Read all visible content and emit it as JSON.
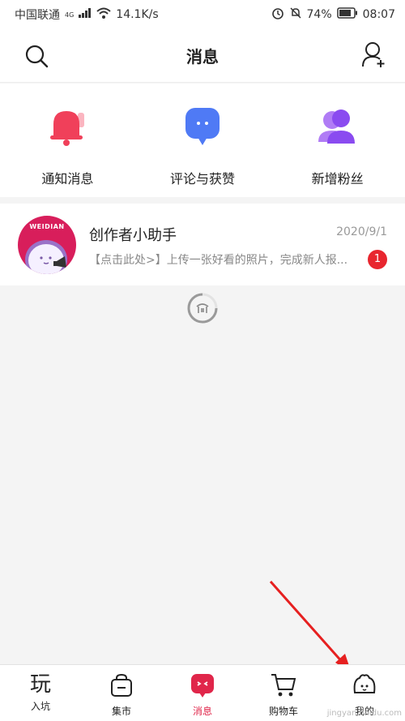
{
  "status_bar": {
    "carrier": "中国联通",
    "network": "4G",
    "speed": "14.1K/s",
    "battery": "74%",
    "time": "08:07"
  },
  "header": {
    "title": "消息"
  },
  "quick_actions": [
    {
      "label": "通知消息",
      "icon": "bell-icon",
      "color": "#f0405a"
    },
    {
      "label": "评论与获赞",
      "icon": "chat-bubble-icon",
      "color": "#4f7af5"
    },
    {
      "label": "新增粉丝",
      "icon": "users-icon",
      "color": "#8a4bf0"
    }
  ],
  "messages": [
    {
      "name": "创作者小助手",
      "date": "2020/9/1",
      "preview": "【点击此处>】上传一张好看的照片，完成新人报...",
      "unread": "1",
      "avatar_brand": "WEIDIAN"
    }
  ],
  "tabbar": [
    {
      "label": "入坑",
      "icon": "wan-glyph-icon",
      "glyph": "玩"
    },
    {
      "label": "集市",
      "icon": "shopping-bag-icon"
    },
    {
      "label": "消息",
      "icon": "message-icon",
      "active": true
    },
    {
      "label": "购物车",
      "icon": "cart-icon"
    },
    {
      "label": "我的",
      "icon": "profile-icon"
    }
  ],
  "watermark": "jingyan.baidu.com",
  "colors": {
    "accent": "#e0264a",
    "badge": "#e8262f"
  }
}
